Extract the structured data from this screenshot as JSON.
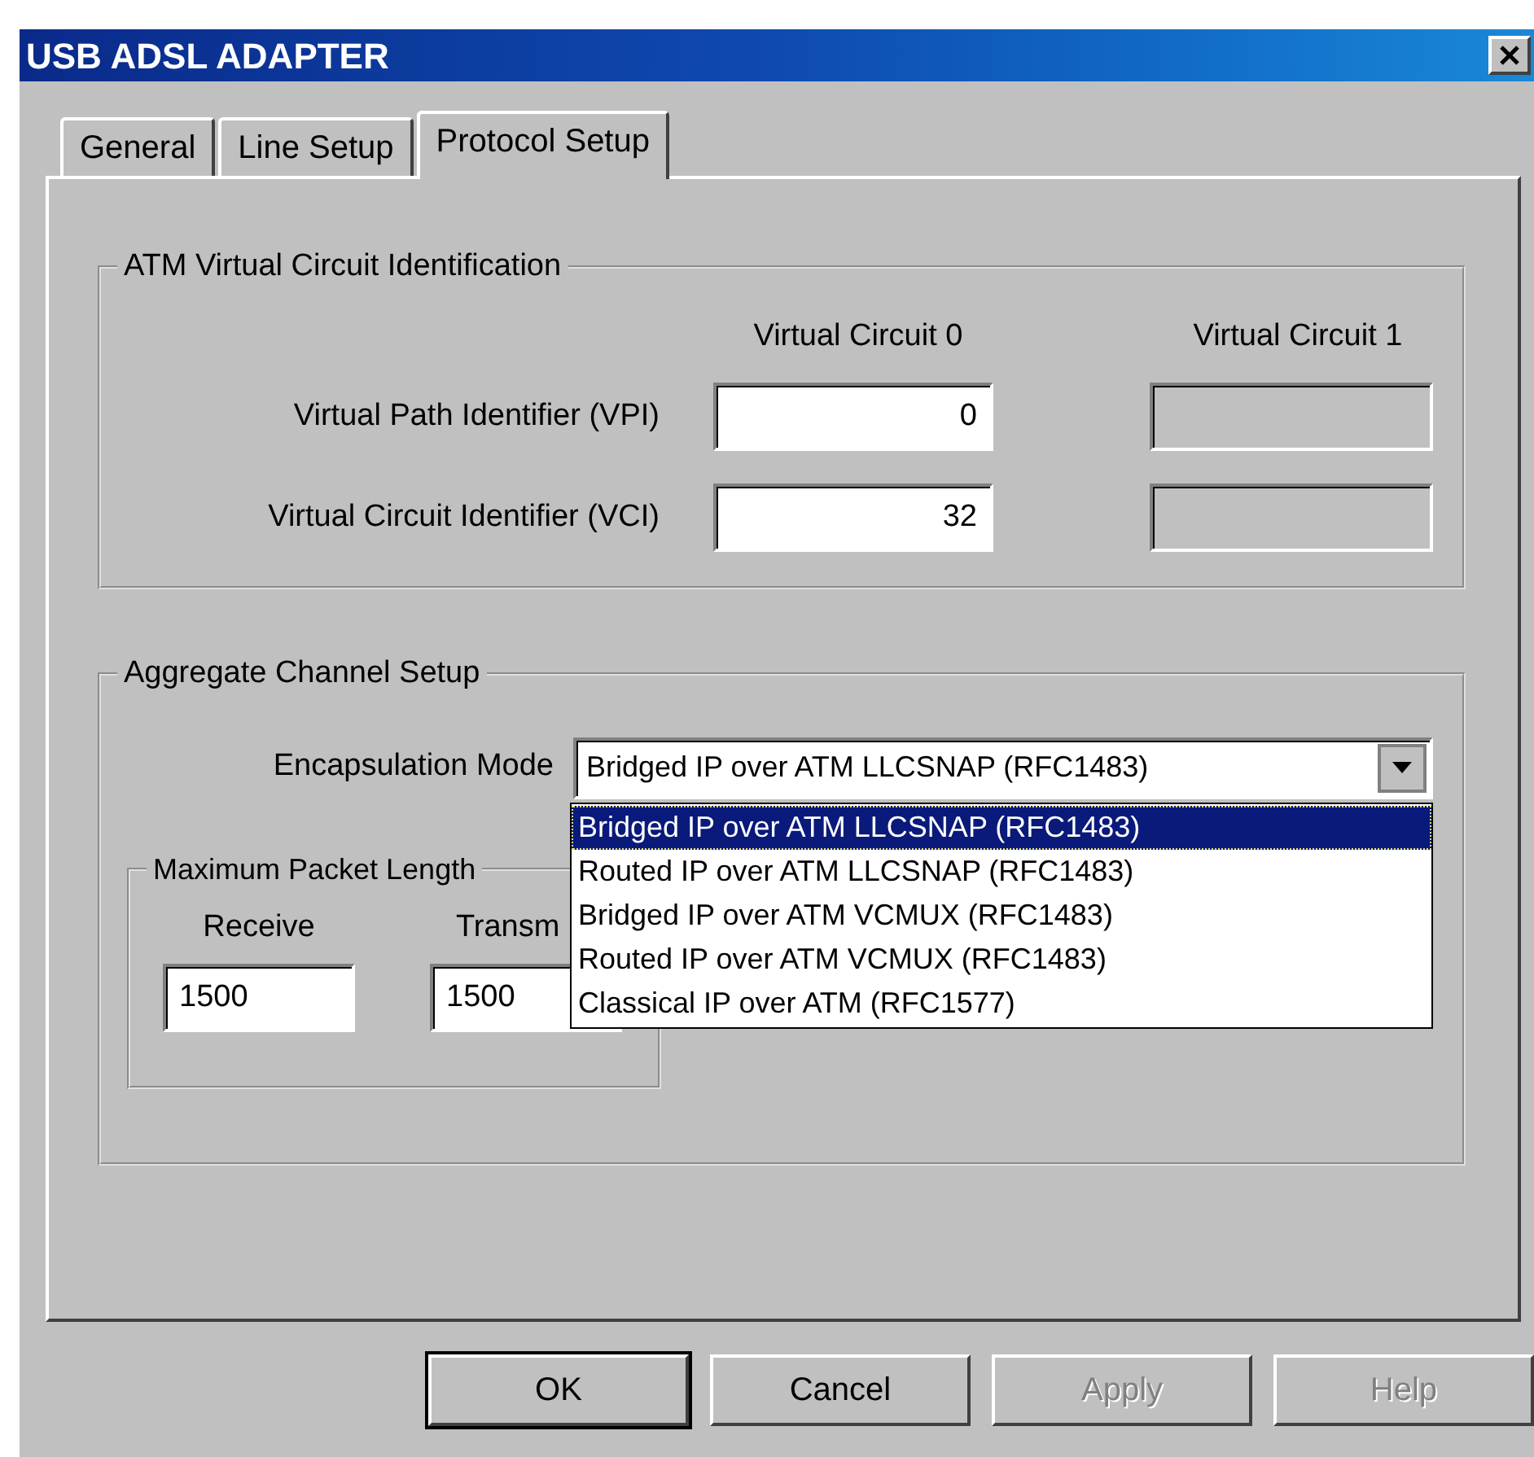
{
  "window": {
    "title": "USB ADSL ADAPTER"
  },
  "tabs": [
    {
      "label": "General",
      "selected": false
    },
    {
      "label": "Line Setup",
      "selected": false
    },
    {
      "label": "Protocol Setup",
      "selected": true
    }
  ],
  "atm_group": {
    "title": "ATM Virtual Circuit Identification",
    "columns": [
      "Virtual Circuit 0",
      "Virtual Circuit 1"
    ],
    "rows": [
      {
        "label": "Virtual Path Identifier (VPI)",
        "circuit_0": {
          "value": "0",
          "disabled": false
        },
        "circuit_1": {
          "disabled": true
        }
      },
      {
        "label": "Virtual Circuit Identifier (VCI)",
        "circuit_0": {
          "value": "32",
          "disabled": false
        },
        "circuit_1": {
          "disabled": true
        }
      }
    ]
  },
  "aggregate_group": {
    "title": "Aggregate Channel Setup",
    "encapsulation": {
      "label": "Encapsulation Mode",
      "value": "Bridged IP over ATM LLCSNAP (RFC1483)",
      "expanded": true,
      "options": [
        {
          "label": "Bridged IP over ATM LLCSNAP (RFC1483)",
          "selected": true
        },
        {
          "label": "Routed IP over ATM LLCSNAP (RFC1483)",
          "selected": false
        },
        {
          "label": "Bridged IP over ATM VCMUX (RFC1483)",
          "selected": false
        },
        {
          "label": "Routed IP over ATM VCMUX (RFC1483)",
          "selected": false
        },
        {
          "label": "Classical IP over ATM (RFC1577)",
          "selected": false
        }
      ]
    },
    "max_packet": {
      "title": "Maximum Packet Length",
      "fields": [
        {
          "label": "Receive",
          "value": "1500"
        },
        {
          "label": "Transm",
          "value": "1500"
        }
      ]
    }
  },
  "buttons": [
    {
      "label": "OK",
      "default": true,
      "disabled": false
    },
    {
      "label": "Cancel",
      "default": false,
      "disabled": false
    },
    {
      "label": "Apply",
      "default": false,
      "disabled": true
    },
    {
      "label": "Help",
      "default": false,
      "disabled": true
    }
  ]
}
